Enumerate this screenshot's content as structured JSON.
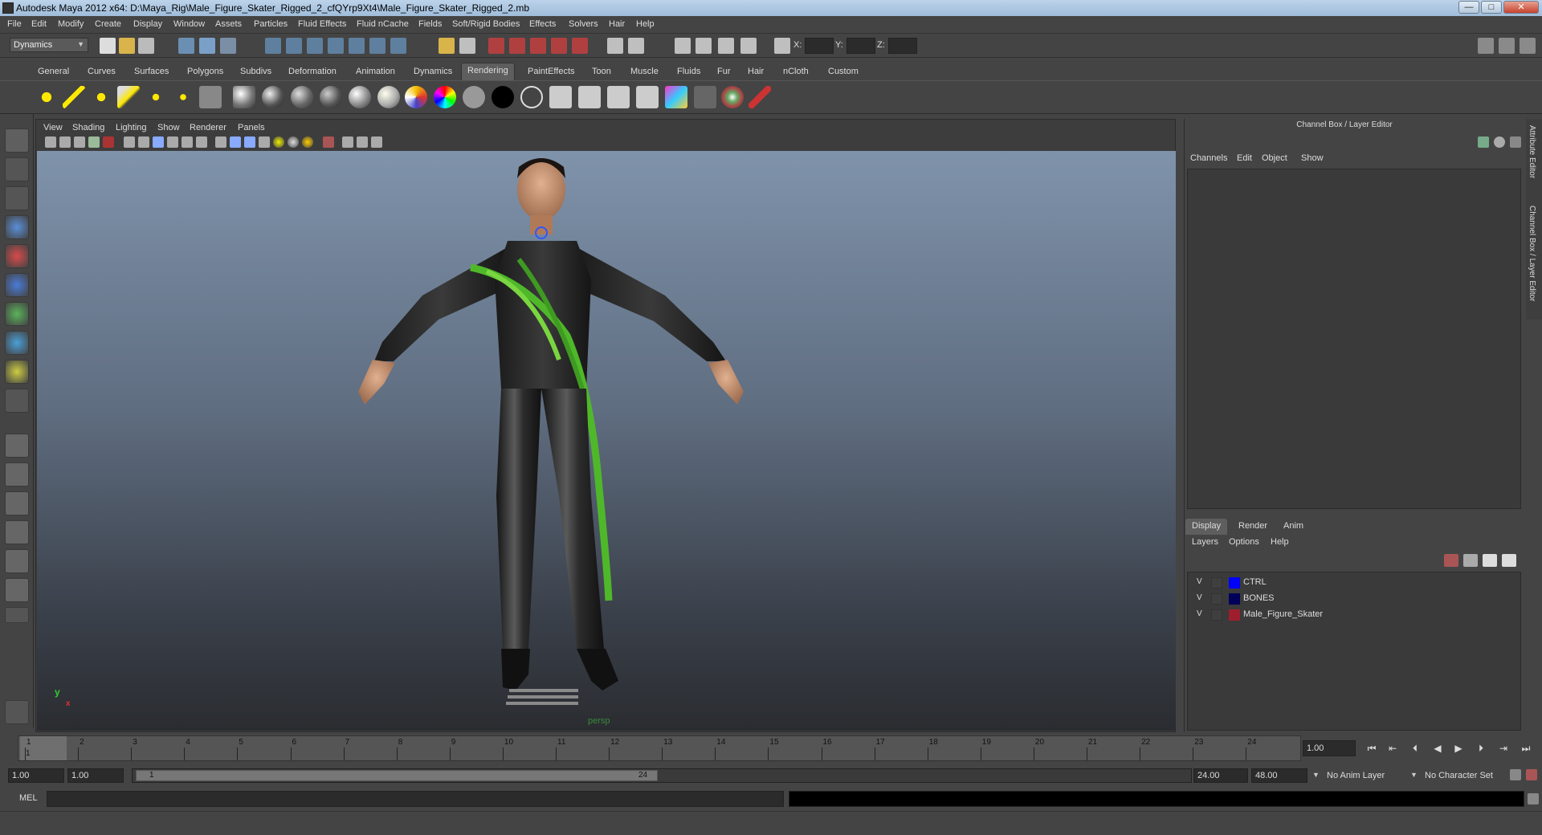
{
  "window": {
    "title": "Autodesk Maya 2012 x64: D:\\Maya_Rig\\Male_Figure_Skater_Rigged_2_cfQYrp9Xt4\\Male_Figure_Skater_Rigged_2.mb",
    "minimize": "—",
    "maximize": "□",
    "close": "✕"
  },
  "menubar": [
    "File",
    "Edit",
    "Modify",
    "Create",
    "Display",
    "Window",
    "Assets",
    "Particles",
    "Fluid Effects",
    "Fluid nCache",
    "Fields",
    "Soft/Rigid Bodies",
    "Effects",
    "Solvers",
    "Hair",
    "Help"
  ],
  "statusline": {
    "menuset": "Dynamics",
    "x_label": "X:",
    "y_label": "Y:",
    "z_label": "Z:"
  },
  "shelf": {
    "tabs": [
      "General",
      "Curves",
      "Surfaces",
      "Polygons",
      "Subdivs",
      "Deformation",
      "Animation",
      "Dynamics",
      "Rendering",
      "PaintEffects",
      "Toon",
      "Muscle",
      "Fluids",
      "Fur",
      "Hair",
      "nCloth",
      "Custom"
    ],
    "active_tab": "Rendering"
  },
  "viewport": {
    "menu": [
      "View",
      "Shading",
      "Lighting",
      "Show",
      "Renderer",
      "Panels"
    ],
    "camera_label": "persp",
    "axis_y": "y",
    "axis_x": "x"
  },
  "channel_box": {
    "title": "Channel Box / Layer Editor",
    "menu": [
      "Channels",
      "Edit",
      "Object",
      "Show"
    ]
  },
  "layer_editor": {
    "tabs": [
      "Display",
      "Render",
      "Anim"
    ],
    "active_tab": "Display",
    "menu": [
      "Layers",
      "Options",
      "Help"
    ],
    "layers": [
      {
        "visible": "V",
        "name": "CTRL",
        "color": "#0000ff"
      },
      {
        "visible": "V",
        "name": "BONES",
        "color": "#00005a"
      },
      {
        "visible": "V",
        "name": "Male_Figure_Skater",
        "color": "#9e1e2e"
      }
    ]
  },
  "side_tabs": [
    "Attribute Editor",
    "Channel Box / Layer Editor"
  ],
  "timeline": {
    "ticks": [
      "1",
      "2",
      "3",
      "4",
      "5",
      "6",
      "7",
      "8",
      "9",
      "10",
      "11",
      "12",
      "13",
      "14",
      "15",
      "16",
      "17",
      "18",
      "19",
      "20",
      "21",
      "22",
      "23",
      "24"
    ],
    "current_frame_marker": "1",
    "current_time": "1.00"
  },
  "range": {
    "start_time": "1.00",
    "playback_start": "1.00",
    "slider_start": "1",
    "slider_end": "24",
    "playback_end": "24.00",
    "end_time": "48.00",
    "anim_layer": "No Anim Layer",
    "character_set": "No Character Set"
  },
  "command_line": {
    "label": "MEL"
  }
}
